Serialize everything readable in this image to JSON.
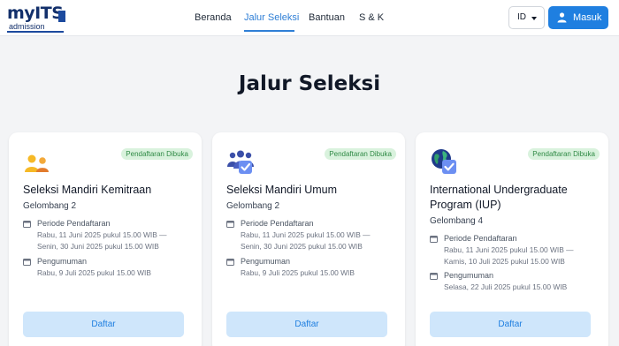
{
  "brand": {
    "logo_main": "myITS",
    "logo_sub": "admission"
  },
  "nav": [
    {
      "label": "Beranda"
    },
    {
      "label": "Jalur Seleksi"
    },
    {
      "label": "Bantuan"
    },
    {
      "label": "S & K"
    }
  ],
  "header": {
    "language": "ID",
    "login_label": "Masuk"
  },
  "page": {
    "title": "Jalur Seleksi"
  },
  "cards": [
    {
      "badge": "Pendaftaran Dibuka",
      "title": "Seleksi Mandiri Kemitraan",
      "wave": "Gelombang 2",
      "registration_label": "Periode Pendaftaran",
      "registration_line1": "Rabu, 11 Juni 2025 pukul 15.00 WIB —",
      "registration_line2": "Senin, 30 Juni 2025 pukul 15.00 WIB",
      "announcement_label": "Pengumuman",
      "announcement_value": "Rabu, 9 Juli 2025 pukul 15.00 WIB",
      "button": "Daftar",
      "icon": "partnership-people-icon"
    },
    {
      "badge": "Pendaftaran Dibuka",
      "title": "Seleksi Mandiri Umum",
      "wave": "Gelombang 2",
      "registration_label": "Periode Pendaftaran",
      "registration_line1": "Rabu, 11 Juni 2025 pukul 15.00 WIB —",
      "registration_line2": "Senin, 30 Juni 2025 pukul 15.00 WIB",
      "announcement_label": "Pengumuman",
      "announcement_value": "Rabu, 9 Juli 2025 pukul 15.00 WIB",
      "button": "Daftar",
      "icon": "group-check-icon"
    },
    {
      "badge": "Pendaftaran Dibuka",
      "title": "International Undergraduate Program (IUP)",
      "wave": "Gelombang 4",
      "registration_label": "Periode Pendaftaran",
      "registration_line1": "Rabu, 11 Juni 2025 pukul 15.00 WIB —",
      "registration_line2": "Kamis, 10 Juli 2025 pukul 15.00 WIB",
      "announcement_label": "Pengumuman",
      "announcement_value": "Selasa, 22 Juli 2025 pukul 15.00 WIB",
      "button": "Daftar",
      "icon": "globe-check-icon"
    }
  ],
  "colors": {
    "accent": "#1f7fe0",
    "nav_active": "#2f7fd6",
    "badge_bg": "#d9f2dd",
    "badge_text": "#2f8a45",
    "button_light": "#cfe6fb"
  }
}
